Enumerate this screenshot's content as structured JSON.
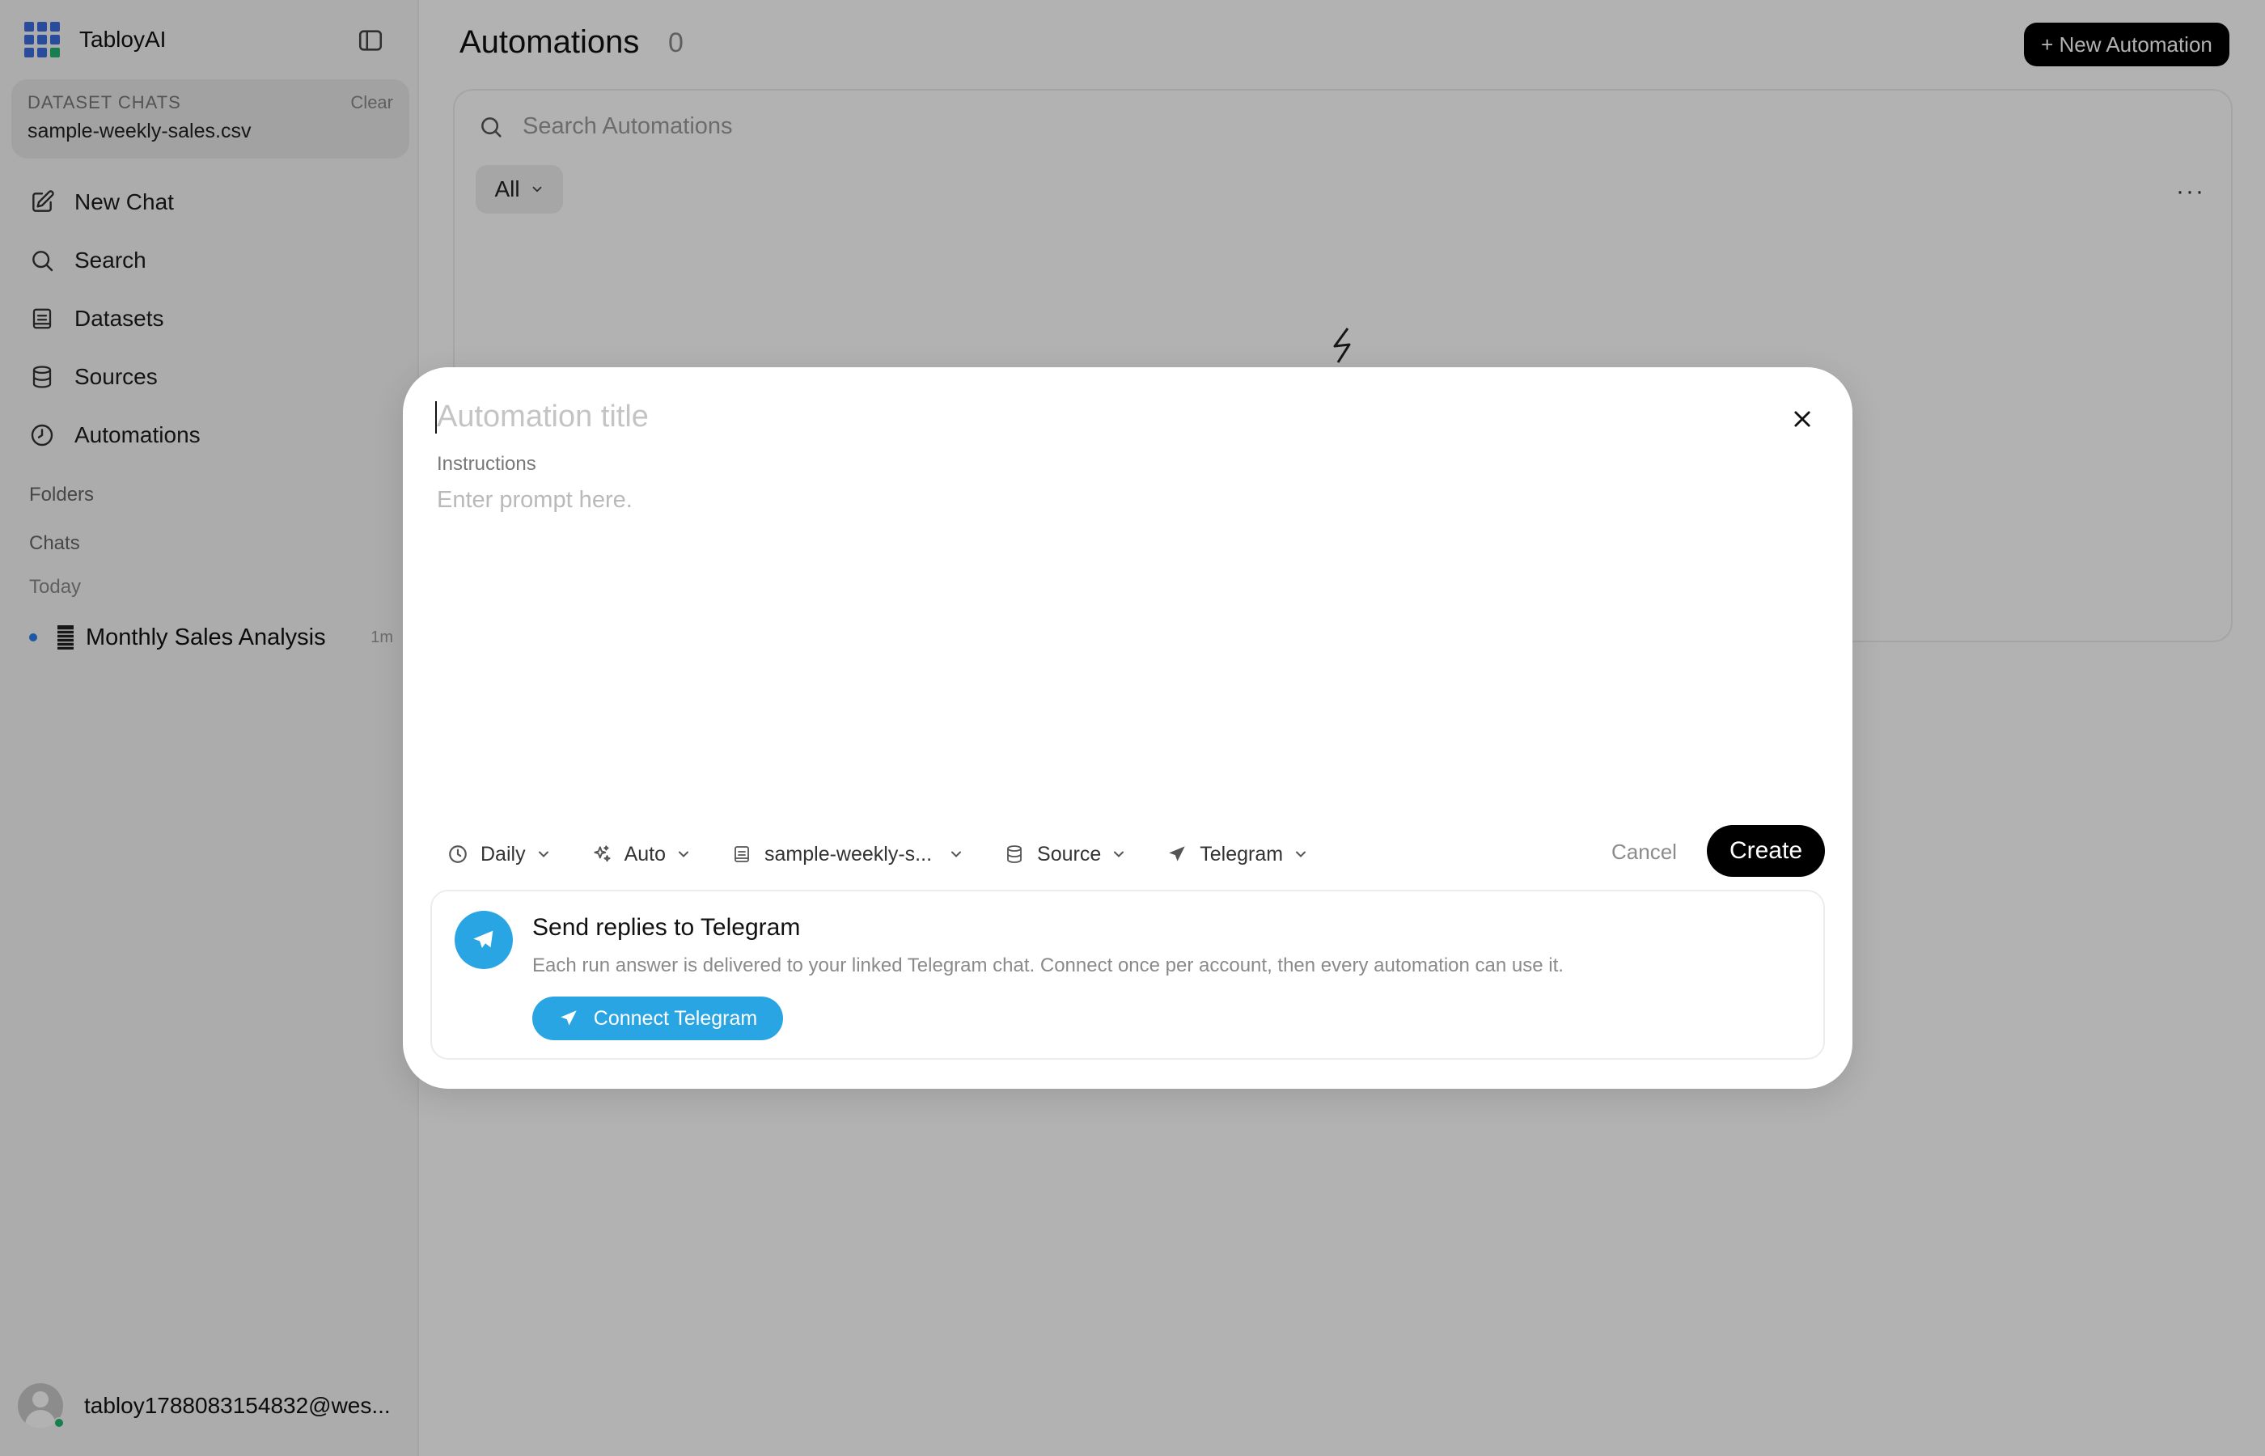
{
  "app": {
    "name": "TabloyAI"
  },
  "sidebar": {
    "dataset_chats": {
      "label": "DATASET CHATS",
      "clear_label": "Clear",
      "file": "sample-weekly-sales.csv"
    },
    "nav": [
      {
        "label": "New Chat",
        "icon": "edit-icon"
      },
      {
        "label": "Search",
        "icon": "search-icon"
      },
      {
        "label": "Datasets",
        "icon": "dataset-icon"
      },
      {
        "label": "Sources",
        "icon": "database-icon"
      },
      {
        "label": "Automations",
        "icon": "clock-icon"
      }
    ],
    "folders_label": "Folders",
    "chats_label": "Chats",
    "today_label": "Today",
    "chats": [
      {
        "name": "Monthly Sales Analysis",
        "time": "1m"
      }
    ],
    "user": {
      "email": "tabloy1788083154832@wes..."
    }
  },
  "main": {
    "title": "Automations",
    "count": "0",
    "new_button": "+ New Automation",
    "search_placeholder": "Search Automations",
    "filter": "All",
    "more": "···"
  },
  "modal": {
    "title_placeholder": "Automation title",
    "instructions_label": "Instructions",
    "prompt_placeholder": "Enter prompt here.",
    "toolbar": {
      "schedule": "Daily",
      "model": "Auto",
      "dataset": "sample-weekly-s...",
      "source": "Source",
      "delivery": "Telegram"
    },
    "cancel": "Cancel",
    "create": "Create",
    "telegram": {
      "title": "Send replies to Telegram",
      "description": "Each run answer is delivered to your linked Telegram chat. Connect once per account, then every automation can use it.",
      "button": "Connect Telegram"
    }
  },
  "colors": {
    "accent": "#2aa5e4",
    "primary_button": "#000000",
    "online": "#22b573",
    "logo_blue": "#3b6fe0"
  }
}
